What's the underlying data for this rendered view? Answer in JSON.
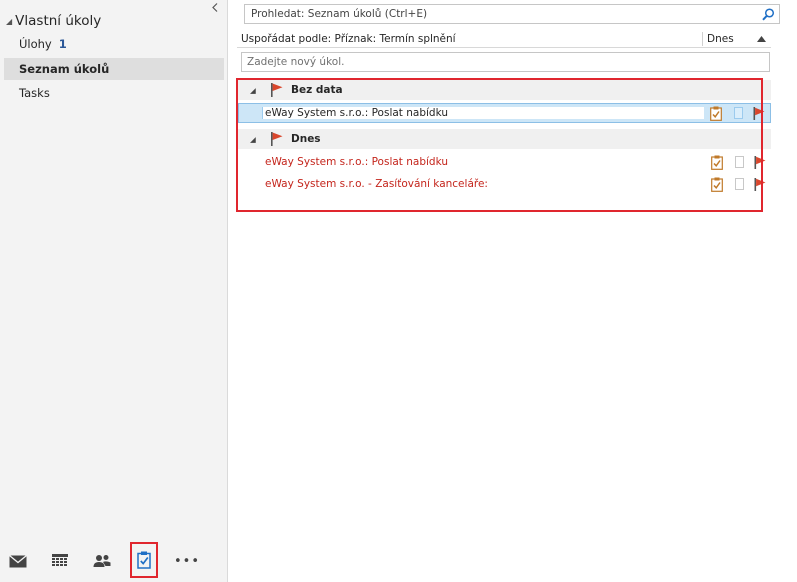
{
  "nav": {
    "folder_title": "Vlastní úkoly",
    "items": [
      {
        "label": "Úlohy",
        "count": "1"
      },
      {
        "label": "Seznam úkolů"
      },
      {
        "label": "Tasks"
      }
    ]
  },
  "bottom_nav": {
    "buttons": [
      "mail-icon",
      "calendar-icon",
      "people-icon",
      "tasks-icon",
      "more-icon"
    ],
    "more_label": "•••"
  },
  "search": {
    "placeholder": "Prohledat: Seznam úkolů (Ctrl+E)"
  },
  "sort": {
    "label": "Uspořádat podle: Příznak: Termín splnění",
    "column": "Dnes"
  },
  "new_task": {
    "placeholder": "Zadejte nový úkol."
  },
  "groups": [
    {
      "name": "Bez data",
      "tasks": [
        {
          "subject": "eWay System s.r.o.: Poslat nabídku",
          "selected": true,
          "overdue": false
        }
      ]
    },
    {
      "name": "Dnes",
      "tasks": [
        {
          "subject": "eWay System s.r.o.: Poslat nabídku",
          "selected": false,
          "overdue": true
        },
        {
          "subject": "eWay System s.r.o. - Zasíťování kanceláře:",
          "selected": false,
          "overdue": true
        }
      ]
    }
  ],
  "colors": {
    "accent": "#2b7cd3",
    "overdue_text": "#c4251c",
    "flag": "#d9462c",
    "highlight": "#e0262e",
    "selection": "#cde6f7"
  }
}
